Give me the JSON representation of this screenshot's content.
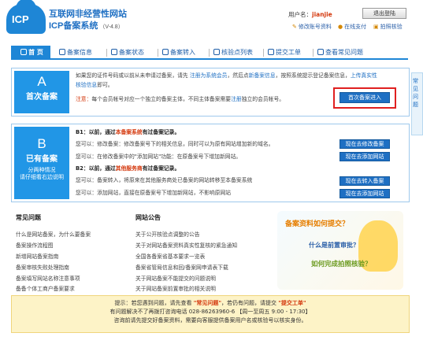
{
  "header": {
    "logo_text": "ICP",
    "title": "互联网非经营性网站",
    "subtitle": "ICP备案系统",
    "version": "（V-4.8）",
    "user_label": "用户名：",
    "username": "jianjie",
    "logout": "退出登陆",
    "links": [
      "修改账号资料",
      "在线支付",
      "拍照核验"
    ]
  },
  "nav": {
    "tabs": [
      "首 页",
      "备案信息",
      "备案状态",
      "备案转入",
      "核验点列表",
      "提交工单",
      "查看常见问题"
    ]
  },
  "sectionA": {
    "letter": "A",
    "title": "首次备案",
    "line1_a": "如果您的证件号码或以前从未申请过备案，请先 ",
    "line1_link1": "注册为系统会员",
    "line1_b": "，然后点",
    "line1_link2": "新备案信息",
    "line1_c": "，按照系统提示登记备案信息，",
    "line1_link3": "上传真实性",
    "line2_link": "核验信息",
    "line2_rest": "即可。",
    "note_label": "注意：",
    "note_text_a": "每个会员帐号对应一个独立的备案主体，不同主体备案需要",
    "note_link": "注册",
    "note_text_b": "独立的会员帐号。",
    "button": "首次备案进入"
  },
  "sectionB": {
    "letter": "B",
    "title": "已有备案",
    "sub1": "分两种情况",
    "sub2": "请仔细看右边说明",
    "b1_head_a": "B1：以前，通过",
    "b1_head_link": "本备案系统",
    "b1_head_b": "有过备案记录。",
    "b1_line1": "您可以：修改备案：修改备案号下的相关信息，同时可以为原有网站增加新的域名。",
    "b1_line2": "您可以：在修改备案中的\"添加网站\"功能：在原备案号下增加新网站。",
    "b2_head_a": "B2：以前，通过",
    "b2_head_link": "其他服务商",
    "b2_head_b": "有过备案记录。",
    "b2_line1": "您可以：备案转入，将原来在其他服务商处已备案的网站转移至本备案系统",
    "b2_line2": "您可以：添加网站，直接在原备案号下增加新网站，不影响原网站",
    "buttons": [
      "现在去修改备案",
      "现在去添加网站",
      "现在去转入备案",
      "现在去添加网站"
    ]
  },
  "faq": {
    "title": "常见问题",
    "items": [
      "什么是网站备案，为什么要备案",
      "备案操作流程图",
      "新增网站备案指南",
      "备案审核失败处理指南",
      "备案填写网站名称注意事项",
      "备备个体工商户备案要求"
    ]
  },
  "announcements": {
    "title": "网站公告",
    "items": [
      "关于公开核验点调整的公告",
      "关于对网站备案资料真实性复核的紧急通知",
      "全国各备案省基本要求一览表",
      "备案省管局信息和回/备案网申请表下载",
      "关于网站备案不能提交的问题说明",
      "关于网站备案前置审批的相关说明"
    ]
  },
  "promo": {
    "q1": "备案资料如何提交？",
    "q2": "什么是前置审批？",
    "q3": "如何完成拍照核验？"
  },
  "footer": {
    "line1_a": "提示：若您遇到问题，请先查看 ",
    "line1_link1": "\"常见问题\"",
    "line1_b": "，若仍有问题，请提交 ",
    "line1_link2": "\"提交工单\"",
    "line2": "有问题解决不了再拨打咨询电话 028-86263960-6 【周一至周五 9:00 - 17:30】",
    "line3": "咨询前请先提交好备案资料，需要向客服提供备案用户名或核验号以核实身份。"
  },
  "sidebar": {
    "label": "常见问题"
  }
}
